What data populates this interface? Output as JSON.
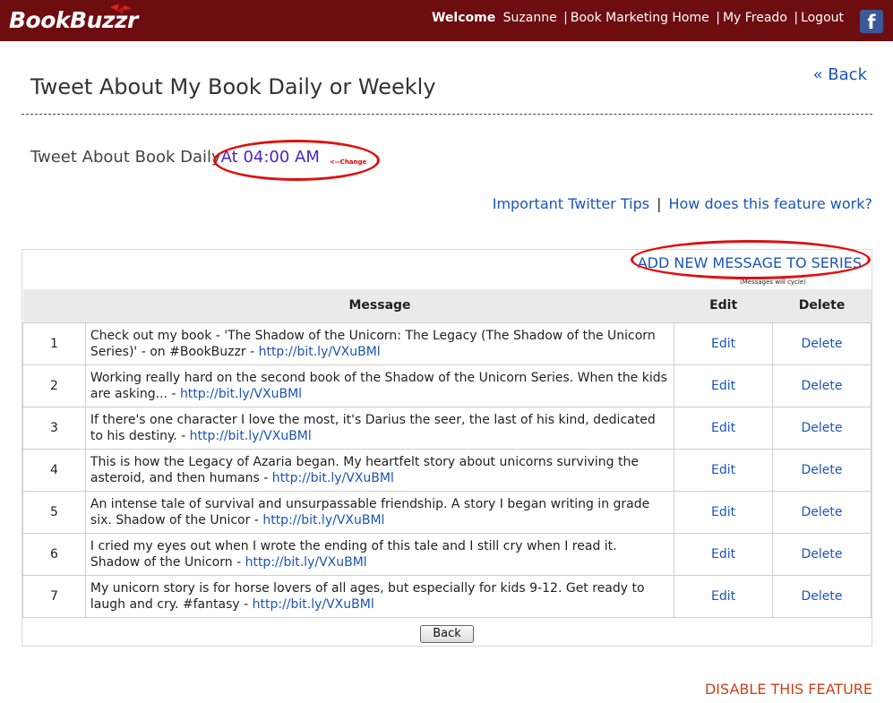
{
  "header": {
    "logo": "BookBuzzr",
    "welcome": "Welcome",
    "user": "Suzanne",
    "nav": [
      "Book Marketing Home",
      "My Freado",
      "Logout"
    ],
    "facebook_glyph": "f",
    "bg_color": "#6e0d10"
  },
  "page": {
    "title": "Tweet About My Book Daily or Weekly",
    "back_link": "« Back"
  },
  "schedule": {
    "label": "Tweet About Book Daily",
    "time": "At 04:00 AM",
    "change": "<--Change"
  },
  "tips": {
    "twitter_tips": "Important Twitter Tips",
    "separator": "|",
    "how_it_works": "How does this feature work?"
  },
  "series": {
    "add_link": "ADD NEW MESSAGE TO SERIES",
    "cycle_note": "(Messages will cycle)"
  },
  "table": {
    "columns": [
      "",
      "Message",
      "Edit",
      "Delete"
    ],
    "rows": [
      {
        "num": "1",
        "text": "Check out my book - 'The Shadow of the Unicorn: The Legacy (The Shadow of the Unicorn Series)' - on #BookBuzzr - ",
        "url": "http://bit.ly/VXuBMl",
        "edit": "Edit",
        "delete": "Delete"
      },
      {
        "num": "2",
        "text": "Working really hard on the second book of the Shadow of the Unicorn Series. When the kids are asking... - ",
        "url": "http://bit.ly/VXuBMl",
        "edit": "Edit",
        "delete": "Delete"
      },
      {
        "num": "3",
        "text": "If there's one character I love the most, it's Darius the seer, the last of his kind, dedicated to his destiny. - ",
        "url": "http://bit.ly/VXuBMl",
        "edit": "Edit",
        "delete": "Delete"
      },
      {
        "num": "4",
        "text": "This is how the Legacy of Azaria began. My heartfelt story about unicorns surviving the asteroid, and then humans - ",
        "url": "http://bit.ly/VXuBMl",
        "edit": "Edit",
        "delete": "Delete"
      },
      {
        "num": "5",
        "text": "An intense tale of survival and unsurpassable friendship. A story I began writing in grade six. Shadow of the Unicor - ",
        "url": "http://bit.ly/VXuBMl",
        "edit": "Edit",
        "delete": "Delete"
      },
      {
        "num": "6",
        "text": "I cried my eyes out when I wrote the ending of this tale and I still cry when I read it. Shadow of the Unicorn - ",
        "url": "http://bit.ly/VXuBMl",
        "edit": "Edit",
        "delete": "Delete"
      },
      {
        "num": "7",
        "text": "My unicorn story is for horse lovers of all ages, but especially for kids 9-12. Get ready to laugh and cry. #fantasy - ",
        "url": "http://bit.ly/VXuBMl",
        "edit": "Edit",
        "delete": "Delete"
      }
    ]
  },
  "buttons": {
    "back": "Back"
  },
  "footer": {
    "disable": "DISABLE THIS FEATURE"
  },
  "colors": {
    "link": "#1a55b8",
    "annotation_red": "#e01010",
    "time_purple": "#4b23c9",
    "disable_orange": "#c8431a"
  }
}
